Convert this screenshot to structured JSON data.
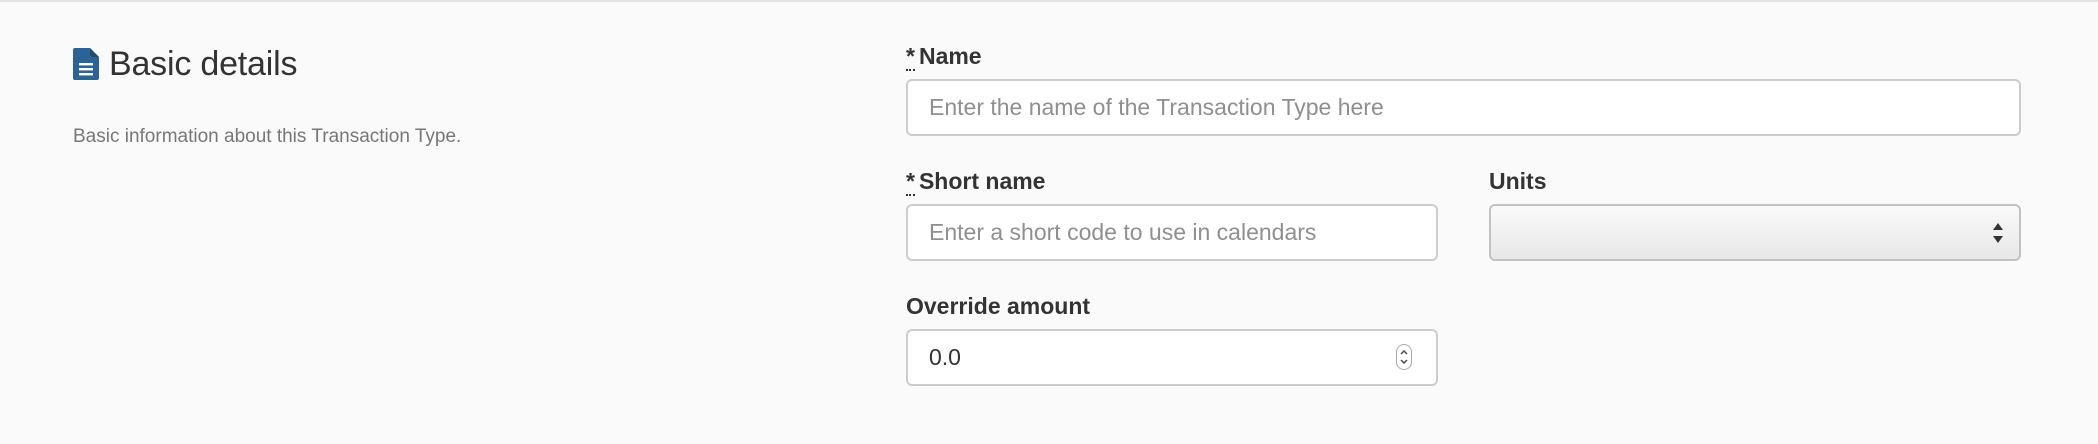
{
  "section": {
    "icon": "document-icon",
    "title": "Basic details",
    "description": "Basic information about this Transaction Type."
  },
  "fields": {
    "name": {
      "required_marker": "*",
      "label": "Name",
      "placeholder": "Enter the name of the Transaction Type here",
      "value": ""
    },
    "short_name": {
      "required_marker": "*",
      "label": "Short name",
      "placeholder": "Enter a short code to use in calendars",
      "value": ""
    },
    "units": {
      "label": "Units",
      "selected": ""
    },
    "override_amount": {
      "label": "Override amount",
      "value": "0.0"
    }
  },
  "colors": {
    "icon": "#2a6496",
    "label": "#333333",
    "description": "#777777",
    "placeholder": "#8f8f8f",
    "border": "#cccccc",
    "background": "#fafafa"
  }
}
